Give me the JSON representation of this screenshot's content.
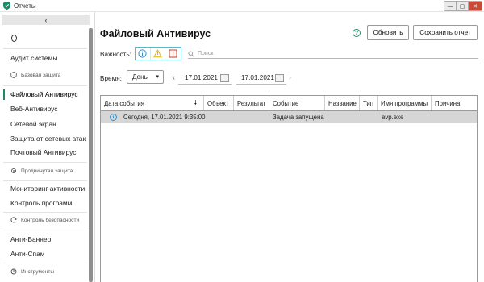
{
  "window": {
    "title": "Отчеты",
    "minimize": "—",
    "maximize": "▢",
    "close": "✕"
  },
  "sidebar": {
    "collapse": "‹",
    "items": [
      {
        "label": "Аудит системы"
      },
      {
        "group": "Базовая защита"
      },
      {
        "label": "Файловый Антивирус",
        "active": true
      },
      {
        "label": "Веб-Антивирус"
      },
      {
        "label": "Сетевой экран"
      },
      {
        "label": "Защита от сетевых атак"
      },
      {
        "label": "Почтовый Антивирус"
      },
      {
        "group": "Продвинутая защита"
      },
      {
        "label": "Мониторинг активности"
      },
      {
        "label": "Контроль программ"
      },
      {
        "group": "Контроль безопасности"
      },
      {
        "label": "Анти-Баннер"
      },
      {
        "label": "Анти-Спам"
      },
      {
        "group": "Инструменты"
      }
    ]
  },
  "main": {
    "title": "Файловый Антивирус",
    "refresh_label": "Обновить",
    "save_report_label": "Сохранить отчет",
    "severity_label": "Важность:",
    "search_placeholder": "Поиск",
    "time_label": "Время:",
    "period": "День",
    "date_from": "17.01.2021",
    "date_to": "17.01.2021",
    "prev": "‹",
    "next": "›"
  },
  "table": {
    "columns": [
      "Дата события",
      "Объект",
      "Результат",
      "Событие",
      "Название",
      "Тип",
      "Имя программы",
      "Причина"
    ],
    "rows": [
      {
        "date": "Сегодня, 17.01.2021 9:35:00",
        "object": "",
        "result": "",
        "event": "Задача запущена",
        "name": "",
        "type": "",
        "program": "avp.exe",
        "reason": ""
      }
    ]
  },
  "colors": {
    "accent": "#1b8a67",
    "info": "#3a8ac0",
    "warning": "#e6b400",
    "critical": "#c0392b",
    "row_selected": "#d6d6d6"
  }
}
